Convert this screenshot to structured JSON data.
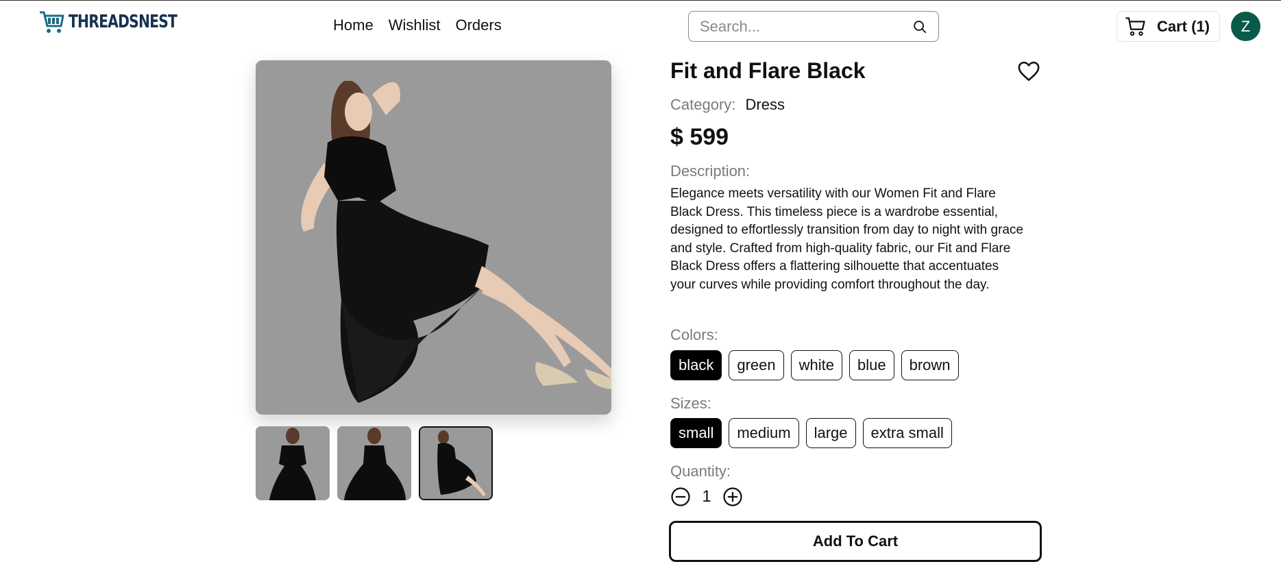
{
  "header": {
    "logo_text": "THREADSNEST",
    "nav": [
      {
        "label": "Home"
      },
      {
        "label": "Wishlist"
      },
      {
        "label": "Orders"
      }
    ],
    "search_placeholder": "Search...",
    "cart_label": "Cart (1)",
    "avatar_initial": "Z"
  },
  "product": {
    "title": "Fit and Flare Black",
    "category_label": "Category:",
    "category_value": "Dress",
    "price": "$ 599",
    "description_label": "Description:",
    "description": "Elegance meets versatility with our Women Fit and Flare Black Dress. This timeless piece is a wardrobe essential, designed to effortlessly transition from day to night with grace and style. Crafted from high-quality fabric, our Fit and Flare Black Dress offers a flattering silhouette that accentuates your curves while providing comfort throughout the day.",
    "colors_label": "Colors:",
    "colors": [
      "black",
      "green",
      "white",
      "blue",
      "brown"
    ],
    "selected_color": "black",
    "sizes_label": "Sizes:",
    "sizes": [
      "small",
      "medium",
      "large",
      "extra small"
    ],
    "selected_size": "small",
    "quantity_label": "Quantity:",
    "quantity": "1",
    "add_to_cart_label": "Add To Cart",
    "thumbnail_count": 3,
    "selected_thumbnail": 3
  },
  "theme": {
    "avatar_bg": "#0a5a4a",
    "image_bg": "#9a9a9a",
    "logo_color": "#16324f"
  }
}
